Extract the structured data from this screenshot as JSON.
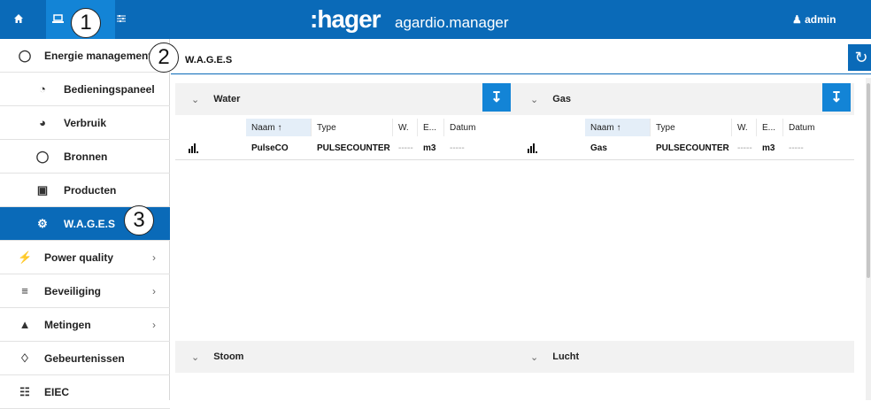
{
  "header": {
    "brand": ":hager",
    "product": "agardio.manager",
    "user": "admin",
    "icons": [
      "home-icon",
      "monitor-icon",
      "sliders-icon"
    ]
  },
  "callouts": [
    "1",
    "2",
    "3"
  ],
  "breadcrumb": "W.A.G.E.S",
  "sidebar": {
    "items": [
      {
        "label": "Energie management",
        "icon": "lightbulb-icon"
      },
      {
        "label": "Bedieningspaneel",
        "icon": "pie-chart-icon"
      },
      {
        "label": "Verbruik",
        "icon": "gauge-icon"
      },
      {
        "label": "Bronnen",
        "icon": "lightbulb-icon"
      },
      {
        "label": "Producten",
        "icon": "box-icon"
      },
      {
        "label": "W.A.G.E.S",
        "icon": "gears-icon"
      },
      {
        "label": "Power quality",
        "icon": "plug-icon"
      },
      {
        "label": "Beveiliging",
        "icon": "sliders-icon"
      },
      {
        "label": "Metingen",
        "icon": "area-chart-icon"
      },
      {
        "label": "Gebeurtenissen",
        "icon": "bell-icon"
      },
      {
        "label": "EIEC",
        "icon": "sitemap-icon"
      }
    ]
  },
  "panels": {
    "water": {
      "title": "Water",
      "columns": [
        "Naam ↑",
        "Type",
        "W.",
        "E...",
        "Datum"
      ],
      "row": {
        "name": "PulseCO",
        "type": "PULSECOUNTER",
        "w": "-----",
        "e": "m3",
        "datum": "-----"
      }
    },
    "gas": {
      "title": "Gas",
      "columns": [
        "Naam ↑",
        "Type",
        "W.",
        "E...",
        "Datum"
      ],
      "row": {
        "name": "Gas",
        "type": "PULSECOUNTER",
        "w": "-----",
        "e": "m3",
        "datum": "-----"
      }
    },
    "stoom": {
      "title": "Stoom"
    },
    "lucht": {
      "title": "Lucht"
    }
  },
  "colors": {
    "primary": "#0a6ab8",
    "accent": "#1384d6",
    "panel_bg": "#f2f2f2"
  }
}
